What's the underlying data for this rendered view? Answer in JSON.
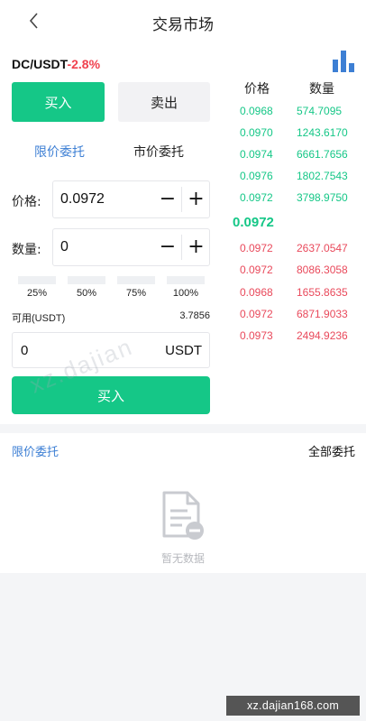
{
  "header": {
    "title": "交易市场"
  },
  "pair": {
    "name": "DC/USDT",
    "change": "-2.8%"
  },
  "trade_tabs": {
    "buy": "买入",
    "sell": "卖出"
  },
  "order_type_tabs": {
    "limit": "限价委托",
    "market": "市价委托"
  },
  "price_field": {
    "label": "价格:",
    "value": "0.0972",
    "minus": "−",
    "plus": "+"
  },
  "qty_field": {
    "label": "数量:",
    "value": "0",
    "minus": "−",
    "plus": "+"
  },
  "percentages": [
    "25%",
    "50%",
    "75%",
    "100%"
  ],
  "available": {
    "label": "可用(USDT)",
    "value": "3.7856"
  },
  "total": {
    "value": "0",
    "unit": "USDT"
  },
  "submit_label": "买入",
  "orderbook": {
    "price_header": "价格",
    "qty_header": "数量",
    "bids": [
      {
        "price": "0.0968",
        "qty": "574.7095"
      },
      {
        "price": "0.0970",
        "qty": "1243.6170"
      },
      {
        "price": "0.0974",
        "qty": "6661.7656"
      },
      {
        "price": "0.0976",
        "qty": "1802.7543"
      },
      {
        "price": "0.0972",
        "qty": "3798.9750"
      }
    ],
    "last_price": "0.0972",
    "asks": [
      {
        "price": "0.0972",
        "qty": "2637.0547"
      },
      {
        "price": "0.0972",
        "qty": "8086.3058"
      },
      {
        "price": "0.0968",
        "qty": "1655.8635"
      },
      {
        "price": "0.0972",
        "qty": "6871.9033"
      },
      {
        "price": "0.0973",
        "qty": "2494.9236"
      }
    ]
  },
  "orders_section": {
    "tab_limit": "限价委托",
    "tab_all": "全部委托",
    "empty_text": "暂无数据"
  },
  "watermark": {
    "text": "xz.dajian",
    "url": "xz.dajian168.com"
  },
  "colors": {
    "green": "#15c787",
    "red": "#e9495b",
    "blue": "#3d7fd4"
  },
  "icons": {
    "back": "chevron-left-icon",
    "chart": "bar-chart-icon",
    "empty": "no-data-document-icon"
  }
}
